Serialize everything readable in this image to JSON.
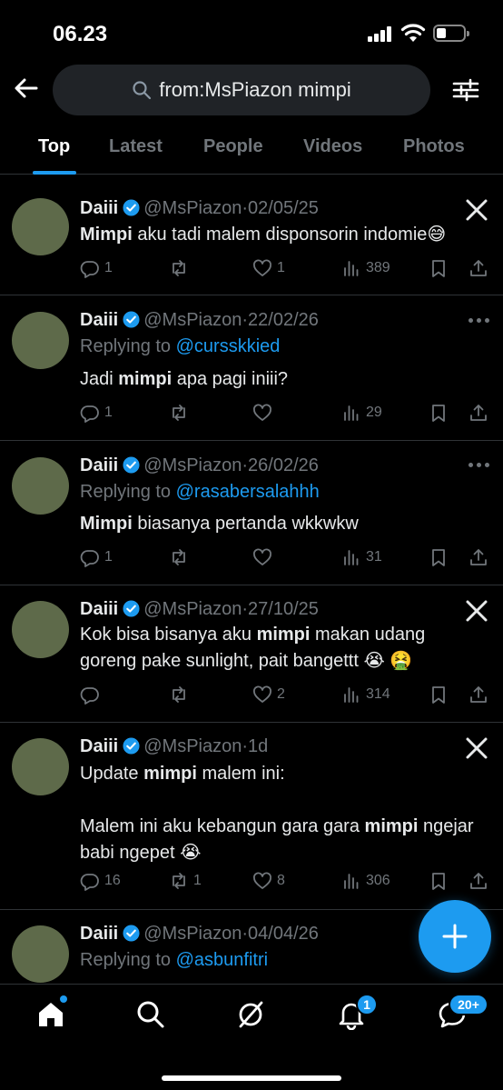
{
  "status_bar": {
    "time": "06.23"
  },
  "search": {
    "query": "from:MsPiazon mimpi"
  },
  "tabs": [
    {
      "label": "Top",
      "active": true
    },
    {
      "label": "Latest",
      "active": false
    },
    {
      "label": "People",
      "active": false
    },
    {
      "label": "Videos",
      "active": false
    },
    {
      "label": "Photos",
      "active": false
    }
  ],
  "tweets": [
    {
      "name": "Daiii",
      "handle": "@MsPiazon",
      "dot": "·",
      "date": "02/05/25",
      "replying_label": "",
      "replying_to": "",
      "body_segments": [
        {
          "text": "Mimpi",
          "bold": true
        },
        {
          "text": " aku tadi malem disponsorin indomie😅",
          "bold": false
        }
      ],
      "corner": "x-logo-icon",
      "replies": "1",
      "retweets": "",
      "likes": "1",
      "views": "389"
    },
    {
      "name": "Daiii",
      "handle": "@MsPiazon",
      "dot": "·",
      "date": "22/02/26",
      "replying_label": "Replying to ",
      "replying_to": "@cursskkied",
      "body_segments": [
        {
          "text": "Jadi ",
          "bold": false
        },
        {
          "text": "mimpi",
          "bold": true
        },
        {
          "text": " apa pagi iniii?",
          "bold": false
        }
      ],
      "corner": "more-icon",
      "replies": "1",
      "retweets": "",
      "likes": "",
      "views": "29"
    },
    {
      "name": "Daiii",
      "handle": "@MsPiazon",
      "dot": "·",
      "date": "26/02/26",
      "replying_label": "Replying to ",
      "replying_to": "@rasabersalahhh",
      "body_segments": [
        {
          "text": "Mimpi",
          "bold": true
        },
        {
          "text": " biasanya pertanda wkkwkw",
          "bold": false
        }
      ],
      "corner": "more-icon",
      "replies": "1",
      "retweets": "",
      "likes": "",
      "views": "31"
    },
    {
      "name": "Daiii",
      "handle": "@MsPiazon",
      "dot": "·",
      "date": "27/10/25",
      "replying_label": "",
      "replying_to": "",
      "body_segments": [
        {
          "text": "Kok bisa bisanya aku ",
          "bold": false
        },
        {
          "text": "mimpi",
          "bold": true
        },
        {
          "text": " makan udang goreng pake sunlight, pait bangettt 😭 🤮",
          "bold": false
        }
      ],
      "corner": "x-logo-icon",
      "replies": "",
      "retweets": "",
      "likes": "2",
      "views": "314"
    },
    {
      "name": "Daiii",
      "handle": "@MsPiazon",
      "dot": "·",
      "date": "1d",
      "replying_label": "",
      "replying_to": "",
      "body_segments": [
        {
          "text": "Update ",
          "bold": false
        },
        {
          "text": "mimpi",
          "bold": true
        },
        {
          "text": " malem ini:\n\nMalem ini aku kebangun gara gara ",
          "bold": false
        },
        {
          "text": "mimpi",
          "bold": true
        },
        {
          "text": " ngejar babi ngepet 😭",
          "bold": false
        }
      ],
      "corner": "x-logo-icon",
      "replies": "16",
      "retweets": "1",
      "likes": "8",
      "views": "306"
    },
    {
      "name": "Daiii",
      "handle": "@MsPiazon",
      "dot": "·",
      "date": "04/04/26",
      "replying_label": "Replying to ",
      "replying_to": "@asbunfitri",
      "body_segments": [],
      "corner": "",
      "replies": "",
      "retweets": "",
      "likes": "",
      "views": ""
    }
  ],
  "bottom_nav": {
    "items": [
      "home-icon",
      "search-icon",
      "grok-icon",
      "notifications-icon",
      "messages-icon"
    ],
    "notifications_badge": "1",
    "messages_badge": "20+"
  },
  "colors": {
    "accent": "#1d9bf0",
    "background": "#000000",
    "muted": "#71767b",
    "text": "#e7e9ea",
    "divider": "#2f3336"
  }
}
